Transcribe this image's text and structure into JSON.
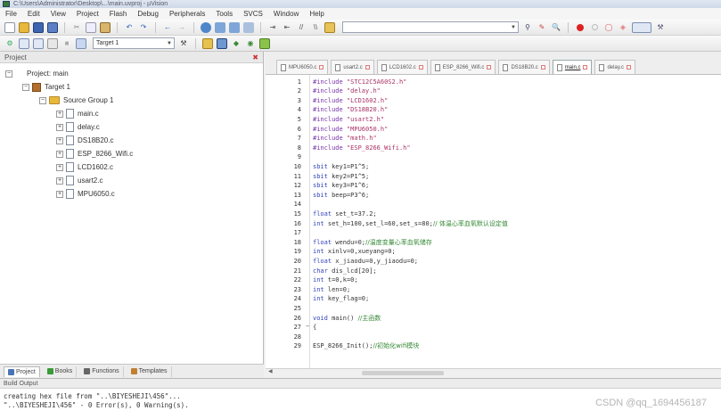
{
  "window": {
    "title": "C:\\Users\\Administrator\\Desktop\\...\\main.uvproj - µVision"
  },
  "menu": [
    "File",
    "Edit",
    "View",
    "Project",
    "Flash",
    "Debug",
    "Peripherals",
    "Tools",
    "SVCS",
    "Window",
    "Help"
  ],
  "toolbar": {
    "target_select": "Target 1",
    "search_box": ""
  },
  "project_panel": {
    "title": "Project",
    "tree": [
      {
        "label": "Project: main",
        "level": 0,
        "kind": "project",
        "expander": "−"
      },
      {
        "label": "Target 1",
        "level": 1,
        "kind": "target",
        "expander": "−"
      },
      {
        "label": "Source Group 1",
        "level": 2,
        "kind": "folder",
        "expander": "−"
      },
      {
        "label": "main.c",
        "level": 3,
        "kind": "file",
        "expander": "+"
      },
      {
        "label": "delay.c",
        "level": 3,
        "kind": "file",
        "expander": "+"
      },
      {
        "label": "DS18B20.c",
        "level": 3,
        "kind": "file",
        "expander": "+"
      },
      {
        "label": "ESP_8266_Wifi.c",
        "level": 3,
        "kind": "file",
        "expander": "+"
      },
      {
        "label": "LCD1602.c",
        "level": 3,
        "kind": "file",
        "expander": "+"
      },
      {
        "label": "usart2.c",
        "level": 3,
        "kind": "file",
        "expander": "+"
      },
      {
        "label": "MPU6050.c",
        "level": 3,
        "kind": "file",
        "expander": "+"
      }
    ],
    "bottom_tabs": [
      {
        "label": "Project",
        "active": true,
        "color": "#4a73b5"
      },
      {
        "label": "Books",
        "active": false,
        "color": "#3a9a3a"
      },
      {
        "label": "Functions",
        "active": false,
        "color": "#666666"
      },
      {
        "label": "Templates",
        "active": false,
        "color": "#c08030"
      }
    ]
  },
  "editor": {
    "tabs": [
      {
        "label": "MPU6050.c",
        "active": false
      },
      {
        "label": "usart2.c",
        "active": false
      },
      {
        "label": "LCD1602.c",
        "active": false
      },
      {
        "label": "ESP_8266_Wifi.c",
        "active": false
      },
      {
        "label": "DS18B20.c",
        "active": false
      },
      {
        "label": "main.c",
        "active": true
      },
      {
        "label": "delay.c",
        "active": false
      }
    ],
    "lines": [
      {
        "n": 1,
        "code": "#include \"STC12C5A60S2.h\""
      },
      {
        "n": 2,
        "code": "#include \"delay.h\""
      },
      {
        "n": 3,
        "code": "#include \"LCD1602.h\""
      },
      {
        "n": 4,
        "code": "#include \"DS18B20.h\""
      },
      {
        "n": 5,
        "code": "#include \"usart2.h\""
      },
      {
        "n": 6,
        "code": "#include \"MPU6050.h\""
      },
      {
        "n": 7,
        "code": "#include \"math.h\""
      },
      {
        "n": 8,
        "code": "#include \"ESP_8266_Wifi.h\""
      },
      {
        "n": 9,
        "code": ""
      },
      {
        "n": 10,
        "code": "sbit key1=P1^5;"
      },
      {
        "n": 11,
        "code": "sbit key2=P1^5;"
      },
      {
        "n": 12,
        "code": "sbit key3=P1^6;"
      },
      {
        "n": 13,
        "code": "sbit beep=P3^6;"
      },
      {
        "n": 14,
        "code": ""
      },
      {
        "n": 15,
        "code": "float set_t=37.2;"
      },
      {
        "n": 16,
        "code": "int set_h=100,set_l=60,set_s=80;//  体温心率血氧默认设定值"
      },
      {
        "n": 17,
        "code": ""
      },
      {
        "n": 18,
        "code": "float wendu=0;//温度变量心率血氧储存"
      },
      {
        "n": 19,
        "code": "int xinlv=0,xueyang=0;"
      },
      {
        "n": 20,
        "code": "float x_jiaodu=0,y_jiaodu=0;"
      },
      {
        "n": 21,
        "code": "char dis_lcd[20];"
      },
      {
        "n": 22,
        "code": "int t=0,k=0;"
      },
      {
        "n": 23,
        "code": "int len=0;"
      },
      {
        "n": 24,
        "code": "int key_flag=0;"
      },
      {
        "n": 25,
        "code": ""
      },
      {
        "n": 26,
        "code": "void main()            //主函数"
      },
      {
        "n": 27,
        "code": "{"
      },
      {
        "n": 28,
        "code": ""
      },
      {
        "n": 29,
        "code": "  ESP_8266_Init();//初始化wifi模块"
      }
    ]
  },
  "build_output": {
    "title": "Build Output",
    "lines": [
      "creating hex file from \"..\\BIYESHEJI\\456\"...",
      "\"..\\BIYESHEJI\\456\" - 0 Error(s), 0 Warning(s)."
    ]
  },
  "watermark": "CSDN @qq_1694456187"
}
